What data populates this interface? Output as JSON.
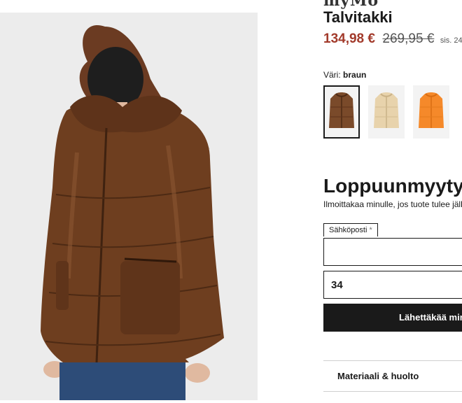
{
  "product": {
    "brand": "myMo",
    "title": "Talvitakki",
    "price_sale": "134,98 €",
    "price_original": "269,95 €",
    "price_note": "sis. 24"
  },
  "color": {
    "label": "Väri:",
    "selected": "braun",
    "options": [
      {
        "name": "braun",
        "hex": "#7a4a2a"
      },
      {
        "name": "beige",
        "hex": "#e8d3ac"
      },
      {
        "name": "orange",
        "hex": "#f5892a"
      }
    ]
  },
  "availability": {
    "heading": "Loppuunmyyty",
    "notify_text": "Ilmoittakaa minulle, jos tuote tulee jälleen"
  },
  "form": {
    "email_label": "Sähköposti",
    "email_required_mark": "*",
    "email_value": "",
    "size_value": "34",
    "submit_label": "Lähettäkää minulle"
  },
  "accordion": {
    "material_label": "Materiaali & huolto"
  }
}
